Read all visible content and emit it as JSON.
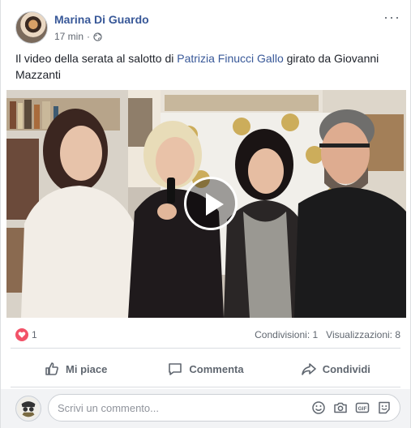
{
  "post": {
    "author": "Marina Di Guardo",
    "time": "17 min",
    "separator": "·",
    "more": "···",
    "text_before": "Il video della serata al salotto di ",
    "mention": "Patrizia Finucci Gallo",
    "text_after": " girato da Giovanni Mazzanti"
  },
  "stats": {
    "reaction_count": "1",
    "summary": "Condivisioni: 1   Visualizzazioni: 8"
  },
  "actions": {
    "like": "Mi piace",
    "comment": "Commenta",
    "share": "Condividi"
  },
  "comment_box": {
    "placeholder": "Scrivi un commento..."
  },
  "colors": {
    "link": "#385898",
    "secondary_text": "#606770",
    "heart": "#f25268"
  },
  "icons": [
    "globe-icon",
    "more-icon",
    "play-icon",
    "heart-icon",
    "like-icon",
    "comment-icon",
    "share-icon",
    "emoji-icon",
    "camera-icon",
    "gif-icon",
    "sticker-icon"
  ]
}
